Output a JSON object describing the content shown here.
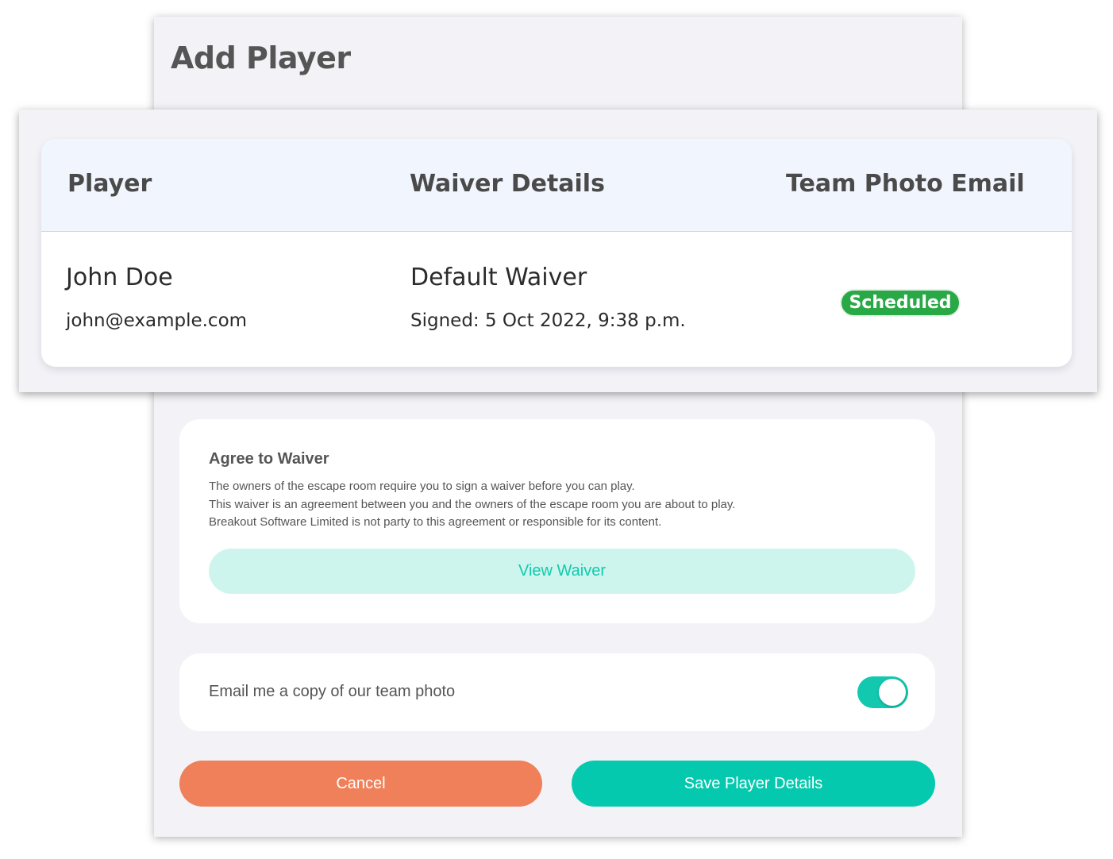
{
  "modal": {
    "title": "Add Player"
  },
  "table": {
    "headers": {
      "player": "Player",
      "waiver": "Waiver Details",
      "photo": "Team Photo Email"
    },
    "row": {
      "name": "John Doe",
      "email": "john@example.com",
      "waiver_name": "Default Waiver",
      "signed": "Signed: 5 Oct 2022, 9:38 p.m.",
      "photo_status": "Scheduled"
    }
  },
  "waiver": {
    "title": "Agree to Waiver",
    "lines": [
      "The owners of the escape room require you to sign a waiver before you can play.",
      "This waiver is an agreement between you and the owners of the escape room you are about to play.",
      "Breakout Software Limited is not party to this agreement or responsible for its content."
    ],
    "view_label": "View Waiver"
  },
  "email": {
    "label": "Email me a copy of our team photo",
    "enabled": true
  },
  "buttons": {
    "cancel": "Cancel",
    "save": "Save Player Details"
  },
  "colors": {
    "accent": "#05c9ae",
    "cancel": "#f08059",
    "status_scheduled": "#29a846"
  }
}
